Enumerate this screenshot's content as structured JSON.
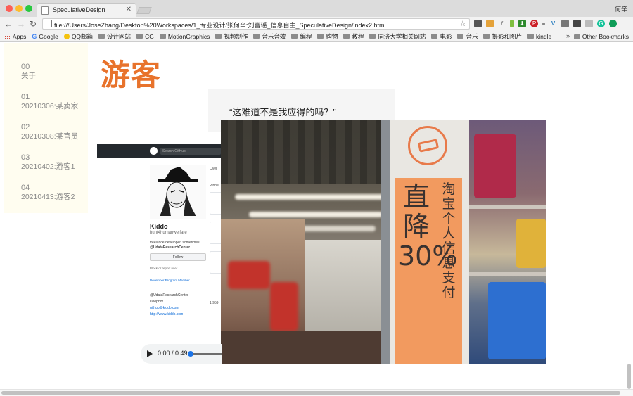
{
  "window": {
    "tab_title": "SpeculativeDesign",
    "user": "何辛"
  },
  "toolbar": {
    "url": "file:///Users/JoseZhang/Desktop%20Workspaces/1_专业设计/张何辛:刘富瑶_信息自主_SpeculativeDesign/index2.html",
    "extensions": [
      "evernote-icon",
      "chrome-color-icon",
      "formula-icon",
      "lamp-icon",
      "download-icon",
      "pinterest-icon",
      "dot-icon",
      "vue-icon",
      "puzzle-icon",
      "cast-icon",
      "shield-icon",
      "grammarly-icon",
      "green-circle-icon"
    ]
  },
  "bookmarks": {
    "items": [
      "Apps",
      "Google",
      "QQ邮箱",
      "设计网站",
      "CG",
      "MotionGraphics",
      "视频制作",
      "音乐音效",
      "编程",
      "购物",
      "教程",
      "同济大学相关网站",
      "电影",
      "音乐",
      "摄影和图片",
      "kindle"
    ],
    "more": "»",
    "other": "Other Bookmarks"
  },
  "sidebar": {
    "items": [
      {
        "num": "00",
        "label": "关于"
      },
      {
        "num": "01",
        "label": "20210306:某卖家"
      },
      {
        "num": "02",
        "label": "20210308:某官员"
      },
      {
        "num": "03",
        "label": "20210402:游客1"
      },
      {
        "num": "04",
        "label": "20210413:游客2"
      }
    ]
  },
  "main": {
    "title": "游客",
    "quote": "“这难道不是我应得的吗？”"
  },
  "github_frame": {
    "search_placeholder": "Search GitHub",
    "name": "Kiddo",
    "login": "hunt4humanwelfare",
    "bio_1": "freelance developer, sometimes",
    "bio_2": "@UdataResearchCenter",
    "follow": "Follow",
    "block": "Block or report user",
    "program": "Developer Program Member",
    "org": "@UdataResearchCenter",
    "location": "Deepnot",
    "email": "github@kiddo.com",
    "website": "http://www.kiddo.com",
    "tab_overview": "Over",
    "pinned": "Pinne",
    "count": "1,959"
  },
  "photo_sign": {
    "big_text": "直降30%",
    "vertical_text": "淘宝个人信息支付"
  },
  "audio": {
    "time": "0:00 / 0:49",
    "progress": 0
  }
}
